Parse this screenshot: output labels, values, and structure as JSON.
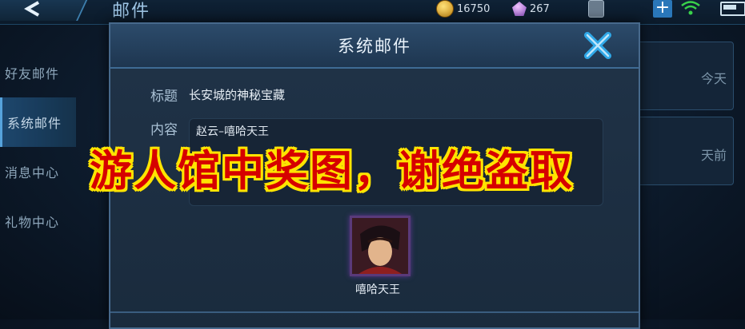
{
  "topbar": {
    "title": "邮件",
    "gold": "16750",
    "gems": "267"
  },
  "sidebar": {
    "items": [
      {
        "label": "好友邮件"
      },
      {
        "label": "系统邮件"
      },
      {
        "label": "消息中心"
      },
      {
        "label": "礼物中心"
      }
    ],
    "active_index": 1
  },
  "background_cards": [
    {
      "time": "今天"
    },
    {
      "time": "天前"
    }
  ],
  "modal": {
    "title": "系统邮件",
    "subject_label": "标题",
    "subject": "长安城的神秘宝藏",
    "content_label": "内容",
    "content": "赵云–嘻哈天王",
    "attachment_name": "嘻哈天王"
  },
  "watermark": "游人馆中奖图，谢绝盗取",
  "colors": {
    "accent": "#5fb3f0",
    "close": "#2fa8e8",
    "watermark_fill": "#d60000",
    "watermark_outline": "#ffe400"
  }
}
